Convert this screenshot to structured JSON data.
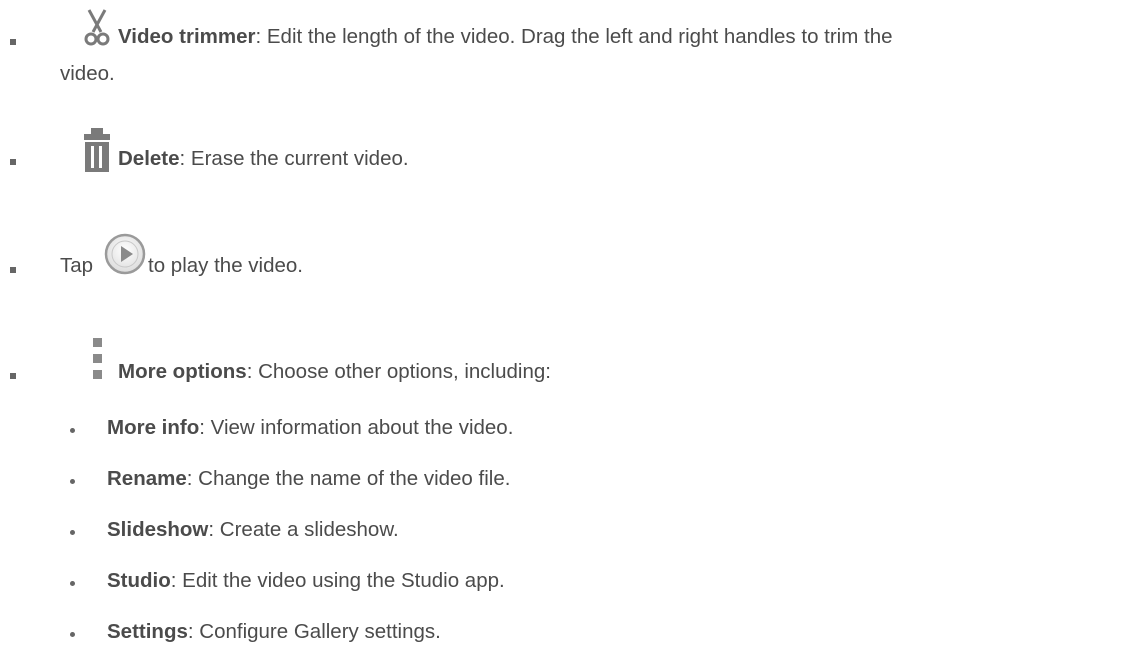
{
  "items": [
    {
      "icon": "scissors-icon",
      "term": "Video trimmer",
      "desc": ": Edit the length of the video. Drag the left and right handles to trim the",
      "desc2": "video."
    },
    {
      "icon": "trash-icon",
      "term": "Delete",
      "desc": ": Erase the current video."
    },
    {
      "icon": "play-icon",
      "pre": "Tap",
      "post": "to play the video."
    },
    {
      "icon": "more-options-icon",
      "term": "More options",
      "desc": ": Choose other options, including:"
    }
  ],
  "subitems": [
    {
      "term": "More info",
      "desc": ": View information about the video."
    },
    {
      "term": "Rename",
      "desc": ": Change the name of the video file."
    },
    {
      "term": "Slideshow",
      "desc": ": Create a slideshow."
    },
    {
      "term": "Studio",
      "desc": ": Edit the video using the Studio app."
    },
    {
      "term": "Settings",
      "desc": ": Configure Gallery settings."
    }
  ],
  "colors": {
    "text": "#4b4b4b",
    "icon": "#7a7a7a"
  }
}
